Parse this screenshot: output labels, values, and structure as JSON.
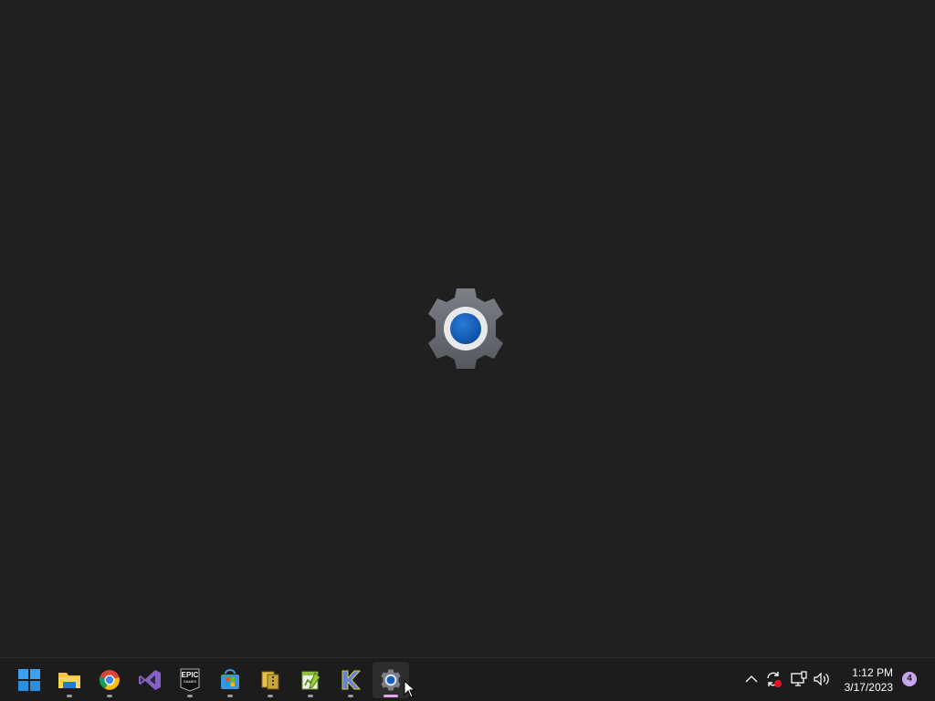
{
  "desktop": {
    "splash_icon": "settings-gear-icon",
    "background_color": "#202020"
  },
  "taskbar": {
    "apps": [
      {
        "name": "start-button",
        "icon": "windows-logo-icon",
        "running": false
      },
      {
        "name": "file-explorer",
        "icon": "folder-icon",
        "running": true
      },
      {
        "name": "chrome",
        "icon": "chrome-icon",
        "running": true
      },
      {
        "name": "visual-studio",
        "icon": "visual-studio-icon",
        "running": false
      },
      {
        "name": "epic-games",
        "icon": "epic-games-icon",
        "running": true
      },
      {
        "name": "microsoft-store",
        "icon": "store-icon",
        "running": true
      },
      {
        "name": "archive-tool",
        "icon": "archive-icon",
        "running": true
      },
      {
        "name": "notepad-plus",
        "icon": "notepad-icon",
        "running": true
      },
      {
        "name": "k-app",
        "icon": "k-icon",
        "running": true
      },
      {
        "name": "settings",
        "icon": "settings-gear-icon",
        "running": true,
        "active": true
      }
    ],
    "epic_label": "EPIC",
    "epic_sub": "GAMES",
    "tray": {
      "icons": [
        "chevron-up-icon",
        "sync-icon",
        "network-icon",
        "volume-icon"
      ],
      "time": "1:12 PM",
      "date": "3/17/2023",
      "notification_count": "4"
    }
  },
  "colors": {
    "taskbar": "#1c1c1c",
    "accent_indicator": "#e6a6e2",
    "badge": "#c7a6e9"
  }
}
